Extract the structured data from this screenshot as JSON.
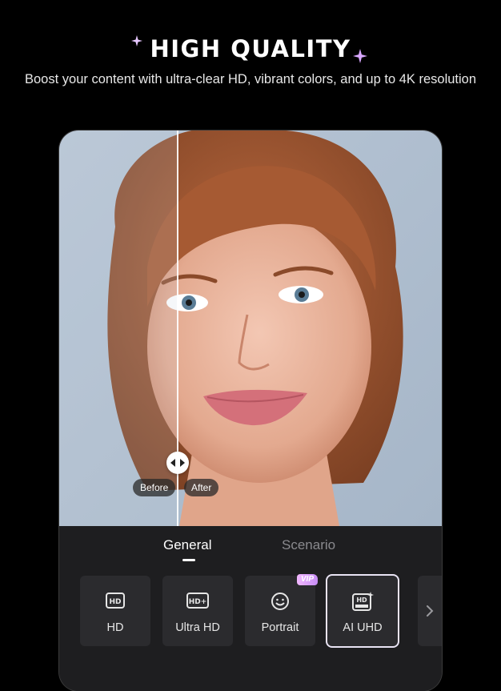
{
  "header": {
    "title": "HIGH QUALITY",
    "subtitle": "Boost your content with ultra-clear HD, vibrant colors, and up to 4K resolution"
  },
  "comparison": {
    "before_label": "Before",
    "after_label": "After",
    "handle_icon": "compare-arrows-icon"
  },
  "tabs": [
    {
      "label": "General",
      "active": true
    },
    {
      "label": "Scenario",
      "active": false
    }
  ],
  "modes": [
    {
      "label": "HD",
      "icon": "hd-icon"
    },
    {
      "label": "Ultra HD",
      "icon": "hd-plus-icon"
    },
    {
      "label": "Portrait",
      "icon": "face-icon",
      "badge": "VIP"
    },
    {
      "label": "AI UHD",
      "icon": "hd-ultra-icon",
      "selected": true
    }
  ],
  "colors": {
    "background": "#000000",
    "panel": "#1e1e20",
    "card": "#2b2b2e",
    "vip_badge": "#d8a0f8"
  }
}
